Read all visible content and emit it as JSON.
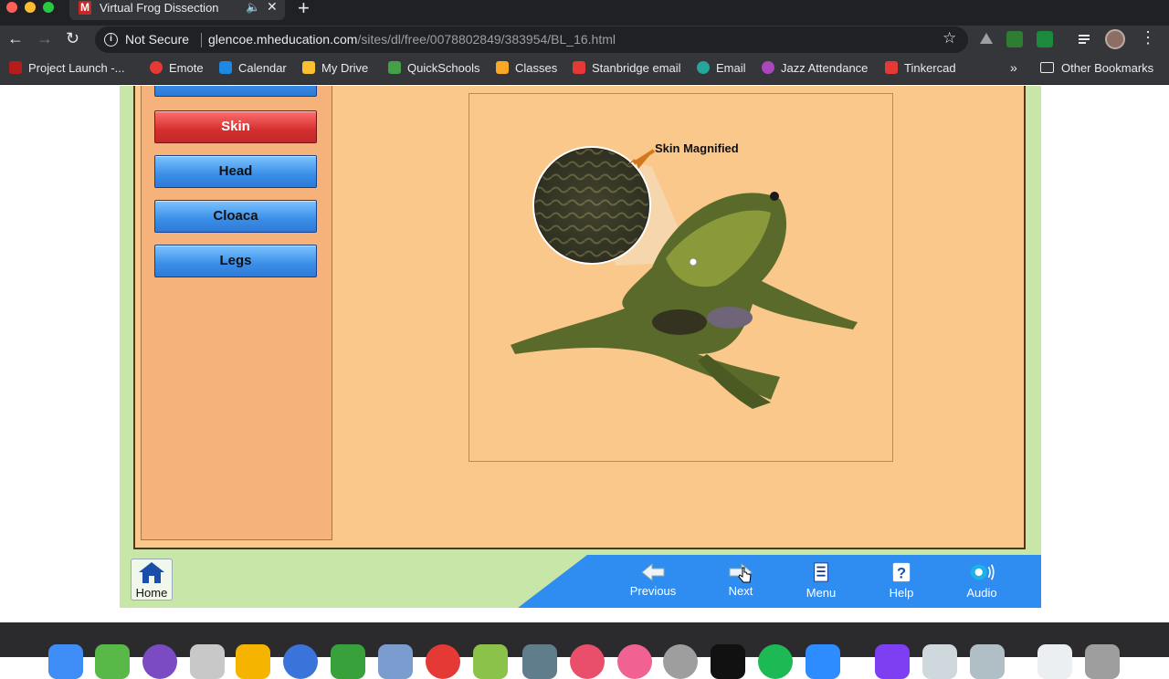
{
  "browser": {
    "tab": {
      "favicon_letter": "M",
      "title": "Virtual Frog Dissection",
      "audio_icon": "speaker-icon",
      "close_glyph": "✕"
    },
    "new_tab_glyph": "+",
    "security": "Not Secure",
    "url_host": "glencoe.mheducation.com",
    "url_path": "/sites/dl/free/0078802849/383954/BL_16.html",
    "bookmarks": [
      {
        "label": "Project Launch -...",
        "color": "#b71c1c"
      },
      {
        "label": "Emote",
        "color": "#e53935"
      },
      {
        "label": "Calendar",
        "color": "#1e88e5"
      },
      {
        "label": "My Drive",
        "color": "#fbc02d"
      },
      {
        "label": "QuickSchools",
        "color": "#43a047"
      },
      {
        "label": "Classes",
        "color": "#f9a825"
      },
      {
        "label": "Stanbridge email",
        "color": "#e53935"
      },
      {
        "label": "Email",
        "color": "#26a69a"
      },
      {
        "label": "Jazz Attendance",
        "color": "#ab47bc"
      },
      {
        "label": "Tinkercad",
        "color": "#e53935"
      }
    ],
    "bookmarks_overflow": "»",
    "other_bookmarks": "Other Bookmarks"
  },
  "sidebar": {
    "items": [
      {
        "label": "Skin",
        "active": true
      },
      {
        "label": "Head",
        "active": false
      },
      {
        "label": "Cloaca",
        "active": false
      },
      {
        "label": "Legs",
        "active": false
      }
    ]
  },
  "stage": {
    "magnify_label": "Skin Magnified"
  },
  "bottom_bar": {
    "home": "Home",
    "previous": "Previous",
    "next": "Next",
    "menu": "Menu",
    "help": "Help",
    "audio": "Audio"
  },
  "colors": {
    "page_bg": "#c8e6a8",
    "panel_bg": "#f9c88a",
    "sidebar_bg": "#f5b27a",
    "nav_blue": "#3a8ee8",
    "nav_active": "#d32f2f",
    "bar_blue": "#2f8cf0"
  }
}
